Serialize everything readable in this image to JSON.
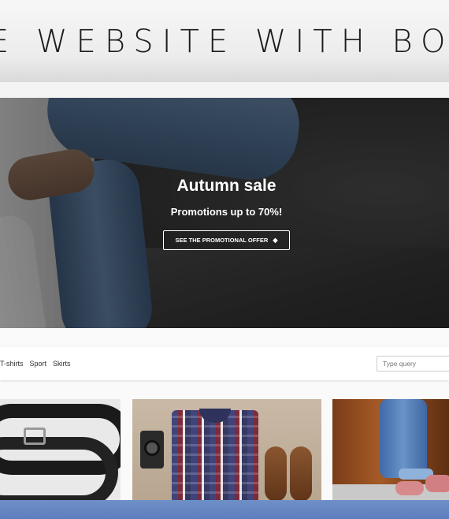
{
  "title_band": {
    "text": "E WEBSITE WITH BOOTST"
  },
  "hero": {
    "title": "Autumn sale",
    "subtitle": "Promotions up to 70%!",
    "button_label": "SEE THE PROMOTIONAL OFFER",
    "button_icon": "diamond-icon"
  },
  "nav": {
    "links": [
      "T-shirts",
      "Sport",
      "Skirts"
    ]
  },
  "search": {
    "placeholder": "Type query"
  },
  "products": [
    {
      "image": "black-belt"
    },
    {
      "image": "flatlay-plaid-shirt-camera-shoes"
    },
    {
      "image": "jeans-sneakers-rust-wall"
    }
  ],
  "colors": {
    "hero_overlay": "#000000",
    "accent_bottom": "#5d7fbd"
  }
}
